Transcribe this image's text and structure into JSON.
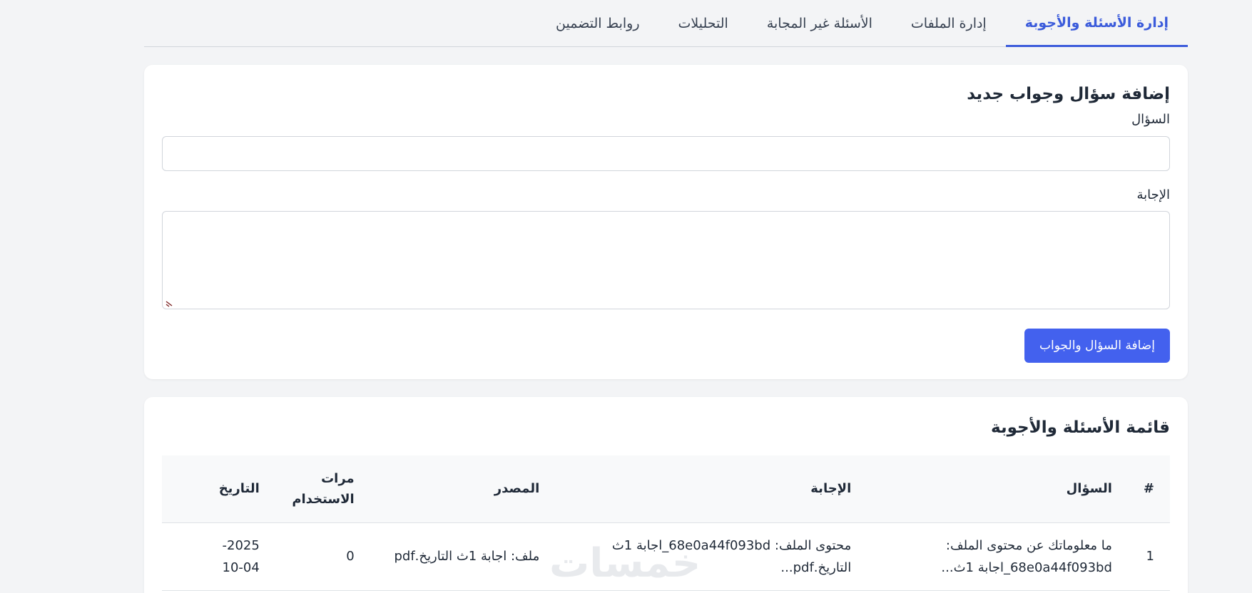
{
  "tabs": [
    {
      "label": "إدارة الأسئلة والأجوبة",
      "active": true
    },
    {
      "label": "إدارة الملفات",
      "active": false
    },
    {
      "label": "الأسئلة غير المجابة",
      "active": false
    },
    {
      "label": "التحليلات",
      "active": false
    },
    {
      "label": "روابط التضمين",
      "active": false
    }
  ],
  "add_form": {
    "title": "إضافة سؤال وجواب جديد",
    "question_label": "السؤال",
    "question_value": "",
    "answer_label": "الإجابة",
    "answer_value": "",
    "submit_label": "إضافة السؤال والجواب"
  },
  "qa_list": {
    "title": "قائمة الأسئلة والأجوبة",
    "columns": {
      "num": "#",
      "question": "السؤال",
      "answer": "الإجابة",
      "source": "المصدر",
      "uses_line1": "مرات",
      "uses_line2": "الاستخدام",
      "date": "التاريخ"
    },
    "rows": [
      {
        "num": "1",
        "question_line1": "ما معلوماتك عن محتوى الملف:",
        "question_line2": "68e0a44f093bd_اجابة 1ث...",
        "answer_line1": "محتوى الملف: 68e0a44f093bd_اجابة 1ث",
        "answer_line2": "التاريخ.pdf...",
        "source": "ملف: اجابة 1ث التاريخ.pdf",
        "uses": "0",
        "date_line1": "2025-",
        "date_line2": "10-04"
      }
    ]
  },
  "watermark": "خمسات",
  "colors": {
    "accent": "#4361ee",
    "tab_active": "#3b5bdb",
    "page_bg": "#f3f4f6",
    "card_bg": "#ffffff",
    "table_header_bg": "#f8f9fa"
  }
}
